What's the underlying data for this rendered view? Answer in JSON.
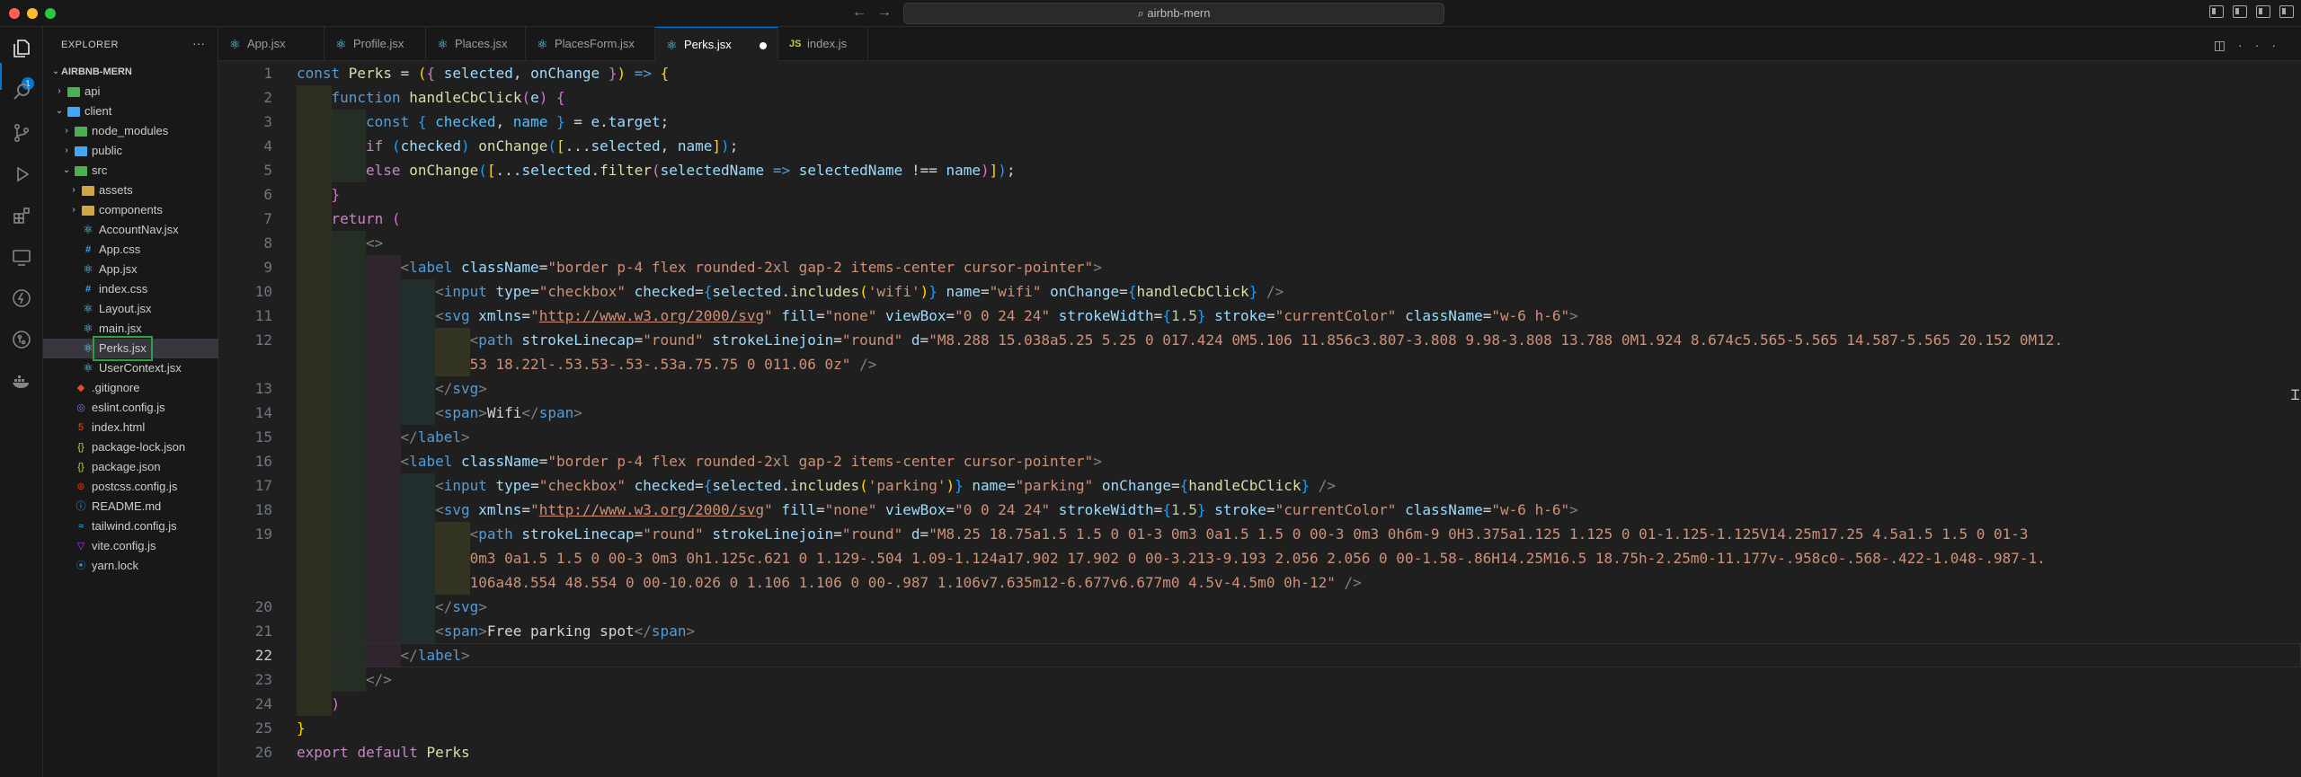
{
  "titlebar": {
    "search_text": "airbnb-mern",
    "back_icon": "arrow-left-icon",
    "forward_icon": "arrow-right-icon"
  },
  "explorer": {
    "title": "EXPLORER",
    "root": "AIRBNB-MERN",
    "items": [
      {
        "label": "api",
        "depth": 1,
        "type": "folder",
        "open": false,
        "icon": "folder-green"
      },
      {
        "label": "client",
        "depth": 1,
        "type": "folder",
        "open": true,
        "icon": "folder-blue"
      },
      {
        "label": "node_modules",
        "depth": 2,
        "type": "folder",
        "open": false,
        "icon": "folder-green"
      },
      {
        "label": "public",
        "depth": 2,
        "type": "folder",
        "open": false,
        "icon": "folder-blue"
      },
      {
        "label": "src",
        "depth": 2,
        "type": "folder",
        "open": true,
        "icon": "folder-green"
      },
      {
        "label": "assets",
        "depth": 3,
        "type": "folder",
        "open": false,
        "icon": "folder-yellow"
      },
      {
        "label": "components",
        "depth": 3,
        "type": "folder",
        "open": false,
        "icon": "folder-yellow"
      },
      {
        "label": "AccountNav.jsx",
        "depth": 3,
        "type": "react"
      },
      {
        "label": "App.css",
        "depth": 3,
        "type": "css"
      },
      {
        "label": "App.jsx",
        "depth": 3,
        "type": "react"
      },
      {
        "label": "index.css",
        "depth": 3,
        "type": "css"
      },
      {
        "label": "Layout.jsx",
        "depth": 3,
        "type": "react"
      },
      {
        "label": "main.jsx",
        "depth": 3,
        "type": "react"
      },
      {
        "label": "Perks.jsx",
        "depth": 3,
        "type": "react",
        "selected": true
      },
      {
        "label": "UserContext.jsx",
        "depth": 3,
        "type": "react"
      },
      {
        "label": ".gitignore",
        "depth": 2,
        "type": "git"
      },
      {
        "label": "eslint.config.js",
        "depth": 2,
        "type": "eslint"
      },
      {
        "label": "index.html",
        "depth": 2,
        "type": "html"
      },
      {
        "label": "package-lock.json",
        "depth": 2,
        "type": "json"
      },
      {
        "label": "package.json",
        "depth": 2,
        "type": "json"
      },
      {
        "label": "postcss.config.js",
        "depth": 2,
        "type": "postcss"
      },
      {
        "label": "README.md",
        "depth": 2,
        "type": "md"
      },
      {
        "label": "tailwind.config.js",
        "depth": 2,
        "type": "tw"
      },
      {
        "label": "vite.config.js",
        "depth": 2,
        "type": "vite"
      },
      {
        "label": "yarn.lock",
        "depth": 2,
        "type": "yarn"
      }
    ]
  },
  "tabs": [
    {
      "label": "App.jsx",
      "type": "react"
    },
    {
      "label": "Profile.jsx",
      "type": "react"
    },
    {
      "label": "Places.jsx",
      "type": "react"
    },
    {
      "label": "PlacesForm.jsx",
      "type": "react"
    },
    {
      "label": "Perks.jsx",
      "type": "react",
      "active": true,
      "dirty": true
    },
    {
      "label": "index.js",
      "type": "js"
    }
  ],
  "activity_badge": "1",
  "editor": {
    "current_line": 22,
    "line_numbers": [
      "1",
      "2",
      "3",
      "4",
      "5",
      "6",
      "7",
      "8",
      "9",
      "10",
      "11",
      "12",
      "",
      "13",
      "14",
      "15",
      "16",
      "17",
      "18",
      "19",
      "",
      "",
      "20",
      "21",
      "22",
      "23",
      "24",
      "25",
      "26"
    ]
  },
  "colors": {
    "accent": "#0078d4",
    "selected_outline": "#2ea043"
  }
}
